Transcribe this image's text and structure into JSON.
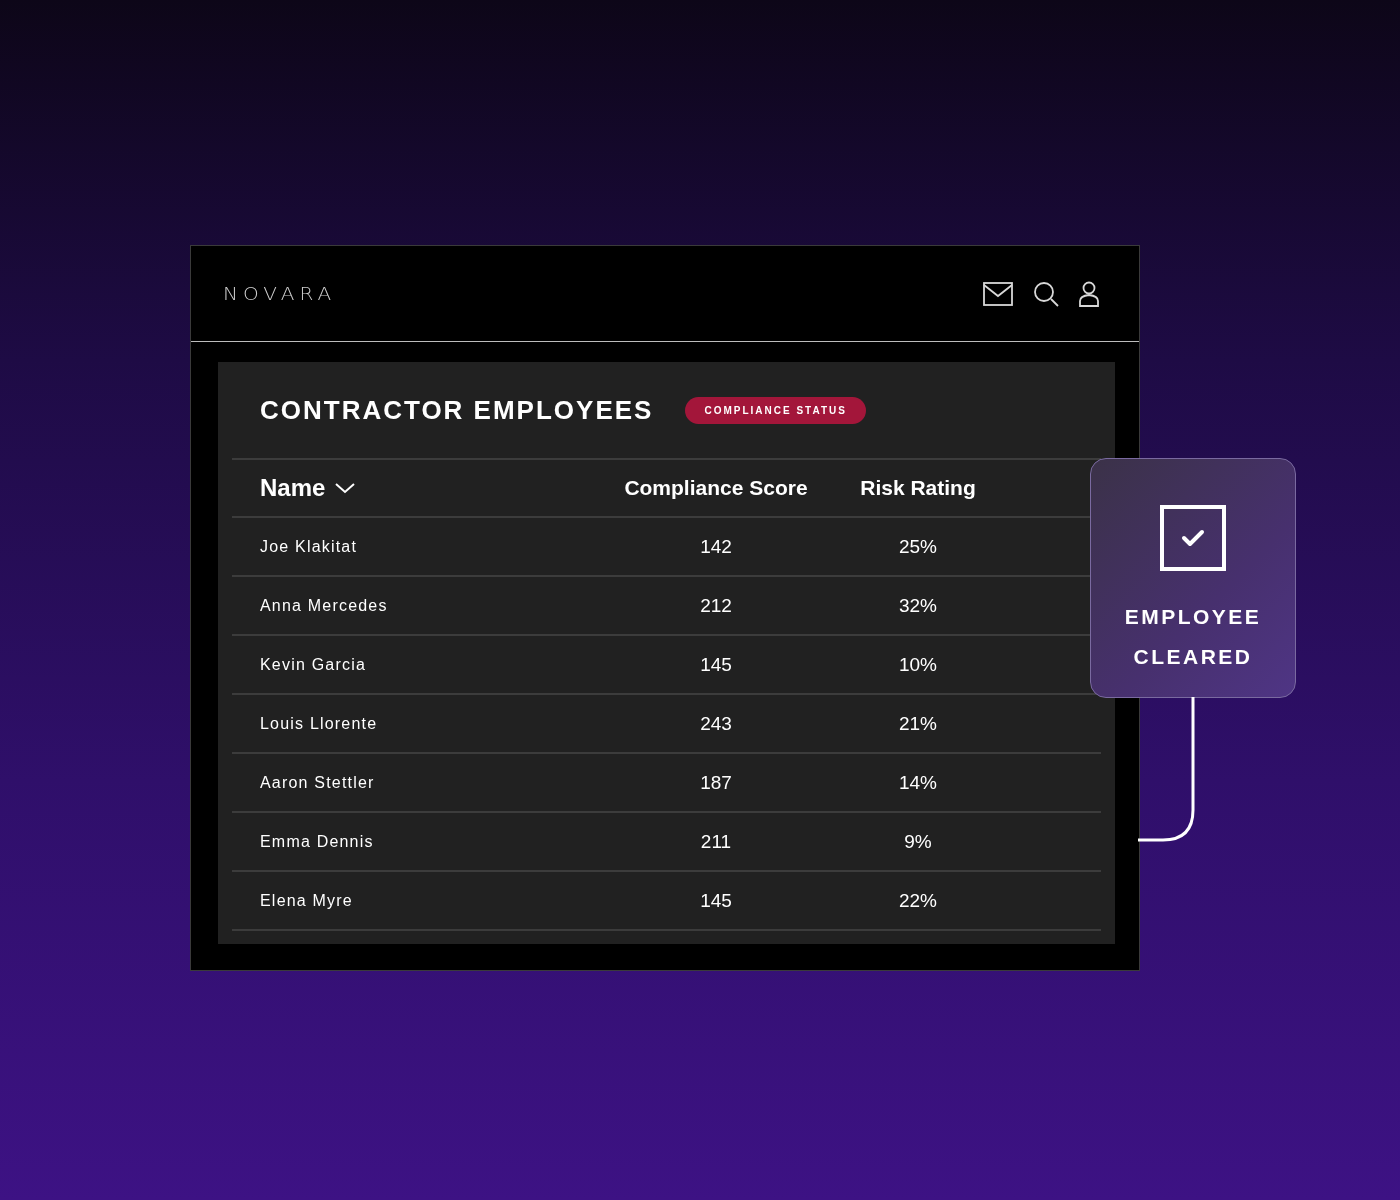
{
  "brand": "NOVARA",
  "panel": {
    "title": "CONTRACTOR EMPLOYEES",
    "badge": "COMPLIANCE STATUS"
  },
  "table": {
    "columns": [
      {
        "label": "Name",
        "sorted": true
      },
      {
        "label": "Compliance Score",
        "sorted": false
      },
      {
        "label": "Risk Rating",
        "sorted": false
      }
    ],
    "rows": [
      [
        "Joe Klakitat",
        "142",
        "25%"
      ],
      [
        "Anna Mercedes",
        "212",
        "32%"
      ],
      [
        "Kevin Garcia",
        "145",
        "10%"
      ],
      [
        "Louis Llorente",
        "243",
        "21%"
      ],
      [
        "Aaron Stettler",
        "187",
        "14%"
      ],
      [
        "Emma Dennis",
        "211",
        "9%"
      ],
      [
        "Elena Myre",
        "145",
        "22%"
      ]
    ]
  },
  "card": {
    "checked": true,
    "lines": [
      "EMPLOYEE",
      "CLEARED"
    ]
  }
}
